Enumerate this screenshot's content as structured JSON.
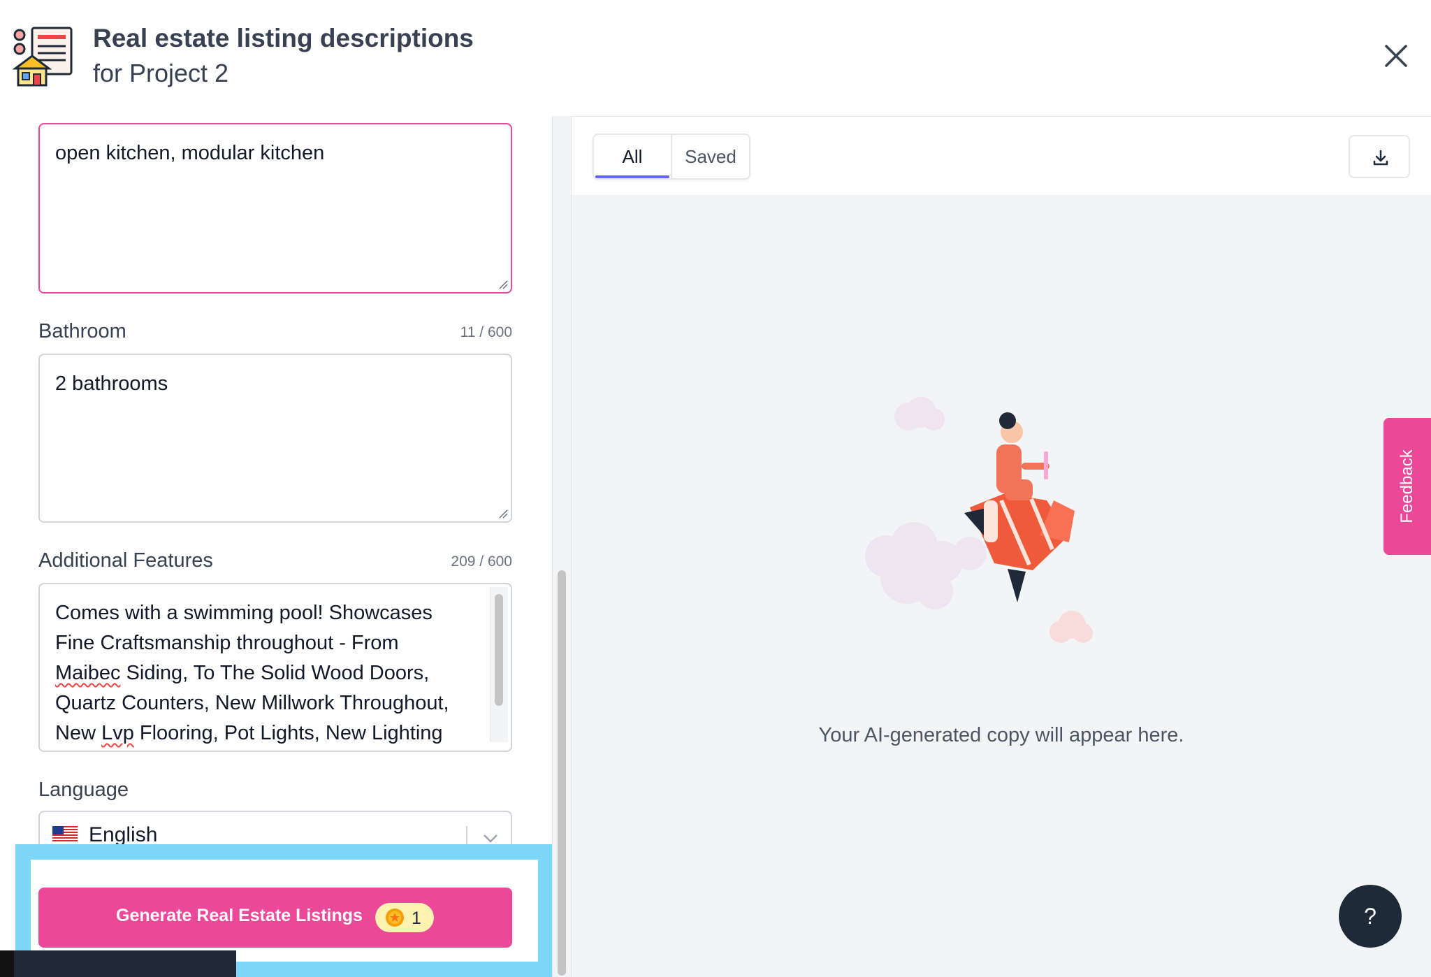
{
  "header": {
    "title": "Real estate listing descriptions",
    "subtitle": "for Project 2"
  },
  "form": {
    "kitchen_value": "open kitchen, modular kitchen",
    "bathroom": {
      "label": "Bathroom",
      "counter": "11 / 600",
      "value": "2 bathrooms"
    },
    "additional": {
      "label": "Additional Features",
      "counter": "209 / 600",
      "line1": "Comes with a swimming pool! Showcases",
      "line2": "Fine Craftsmanship throughout - From",
      "line3_word": "Maibec",
      "line3_rest": " Siding, To The Solid Wood Doors,",
      "line4": "Quartz Counters, New Millwork Throughout,",
      "line5_pre": "New ",
      "line5_word": "Lvp",
      "line5_rest": " Flooring, Pot Lights, New Lighting"
    },
    "language": {
      "label": "Language",
      "value": "English"
    },
    "generate": {
      "label": "Generate Real Estate Listings",
      "credits": "1"
    }
  },
  "results": {
    "tabs": [
      "All",
      "Saved"
    ],
    "active_tab": "All",
    "empty_message": "Your AI-generated copy will appear here."
  },
  "feedback_label": "Feedback",
  "help_label": "?",
  "colors": {
    "accent": "#ec4899",
    "tab_indicator": "#6366f1",
    "highlight": "#7dd8f7",
    "help_bg": "#1e2a38"
  }
}
